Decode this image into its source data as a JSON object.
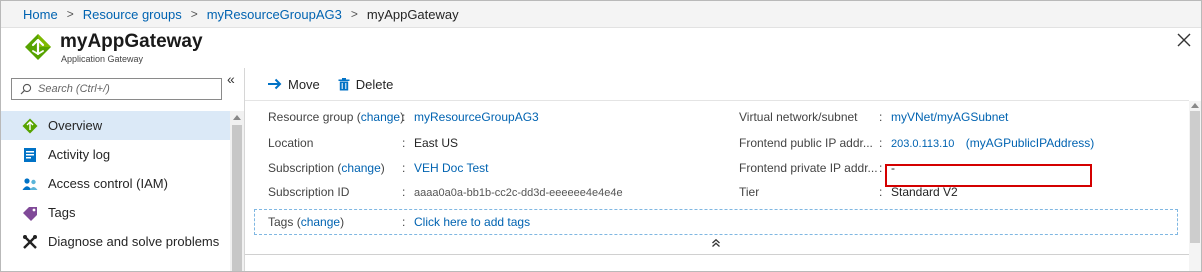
{
  "breadcrumb": {
    "items": [
      "Home",
      "Resource groups",
      "myResourceGroupAG3"
    ],
    "current": "myAppGateway"
  },
  "header": {
    "title": "myAppGateway",
    "subtitle": "Application Gateway",
    "icon": "application-gateway-icon"
  },
  "sidebar": {
    "search_placeholder": "Search (Ctrl+/)",
    "collapse_glyph": "«",
    "items": [
      {
        "label": "Overview",
        "icon": "overview-icon",
        "active": true
      },
      {
        "label": "Activity log",
        "icon": "activity-log-icon"
      },
      {
        "label": "Access control (IAM)",
        "icon": "iam-icon"
      },
      {
        "label": "Tags",
        "icon": "tag-icon"
      },
      {
        "label": "Diagnose and solve problems",
        "icon": "wrench-icon"
      }
    ]
  },
  "toolbar": {
    "move_label": "Move",
    "delete_label": "Delete"
  },
  "essentials": {
    "resource_group": {
      "label": "Resource group",
      "change": "change",
      "value": "myResourceGroupAG3"
    },
    "location": {
      "label": "Location",
      "value": "East US"
    },
    "subscription": {
      "label": "Subscription",
      "change": "change",
      "value": "VEH Doc Test"
    },
    "subscription_id": {
      "label": "Subscription ID",
      "value": "aaaa0a0a-bb1b-cc2c-dd3d-eeeeee4e4e4e"
    },
    "vnet": {
      "label": "Virtual network/subnet",
      "value": "myVNet/myAGSubnet"
    },
    "frontend_public_ip": {
      "label": "Frontend public IP addr...",
      "ip": "203.0.113.10",
      "name": "(myAGPublicIPAddress)"
    },
    "frontend_private_ip": {
      "label": "Frontend private IP addr...",
      "value": "-"
    },
    "tier": {
      "label": "Tier",
      "value": "Standard V2"
    },
    "tags": {
      "label": "Tags",
      "change": "change",
      "value": "Click here to add tags"
    }
  },
  "colors": {
    "link": "#0063b1",
    "highlight": "#d40000",
    "active_nav": "#dbe9f7"
  }
}
